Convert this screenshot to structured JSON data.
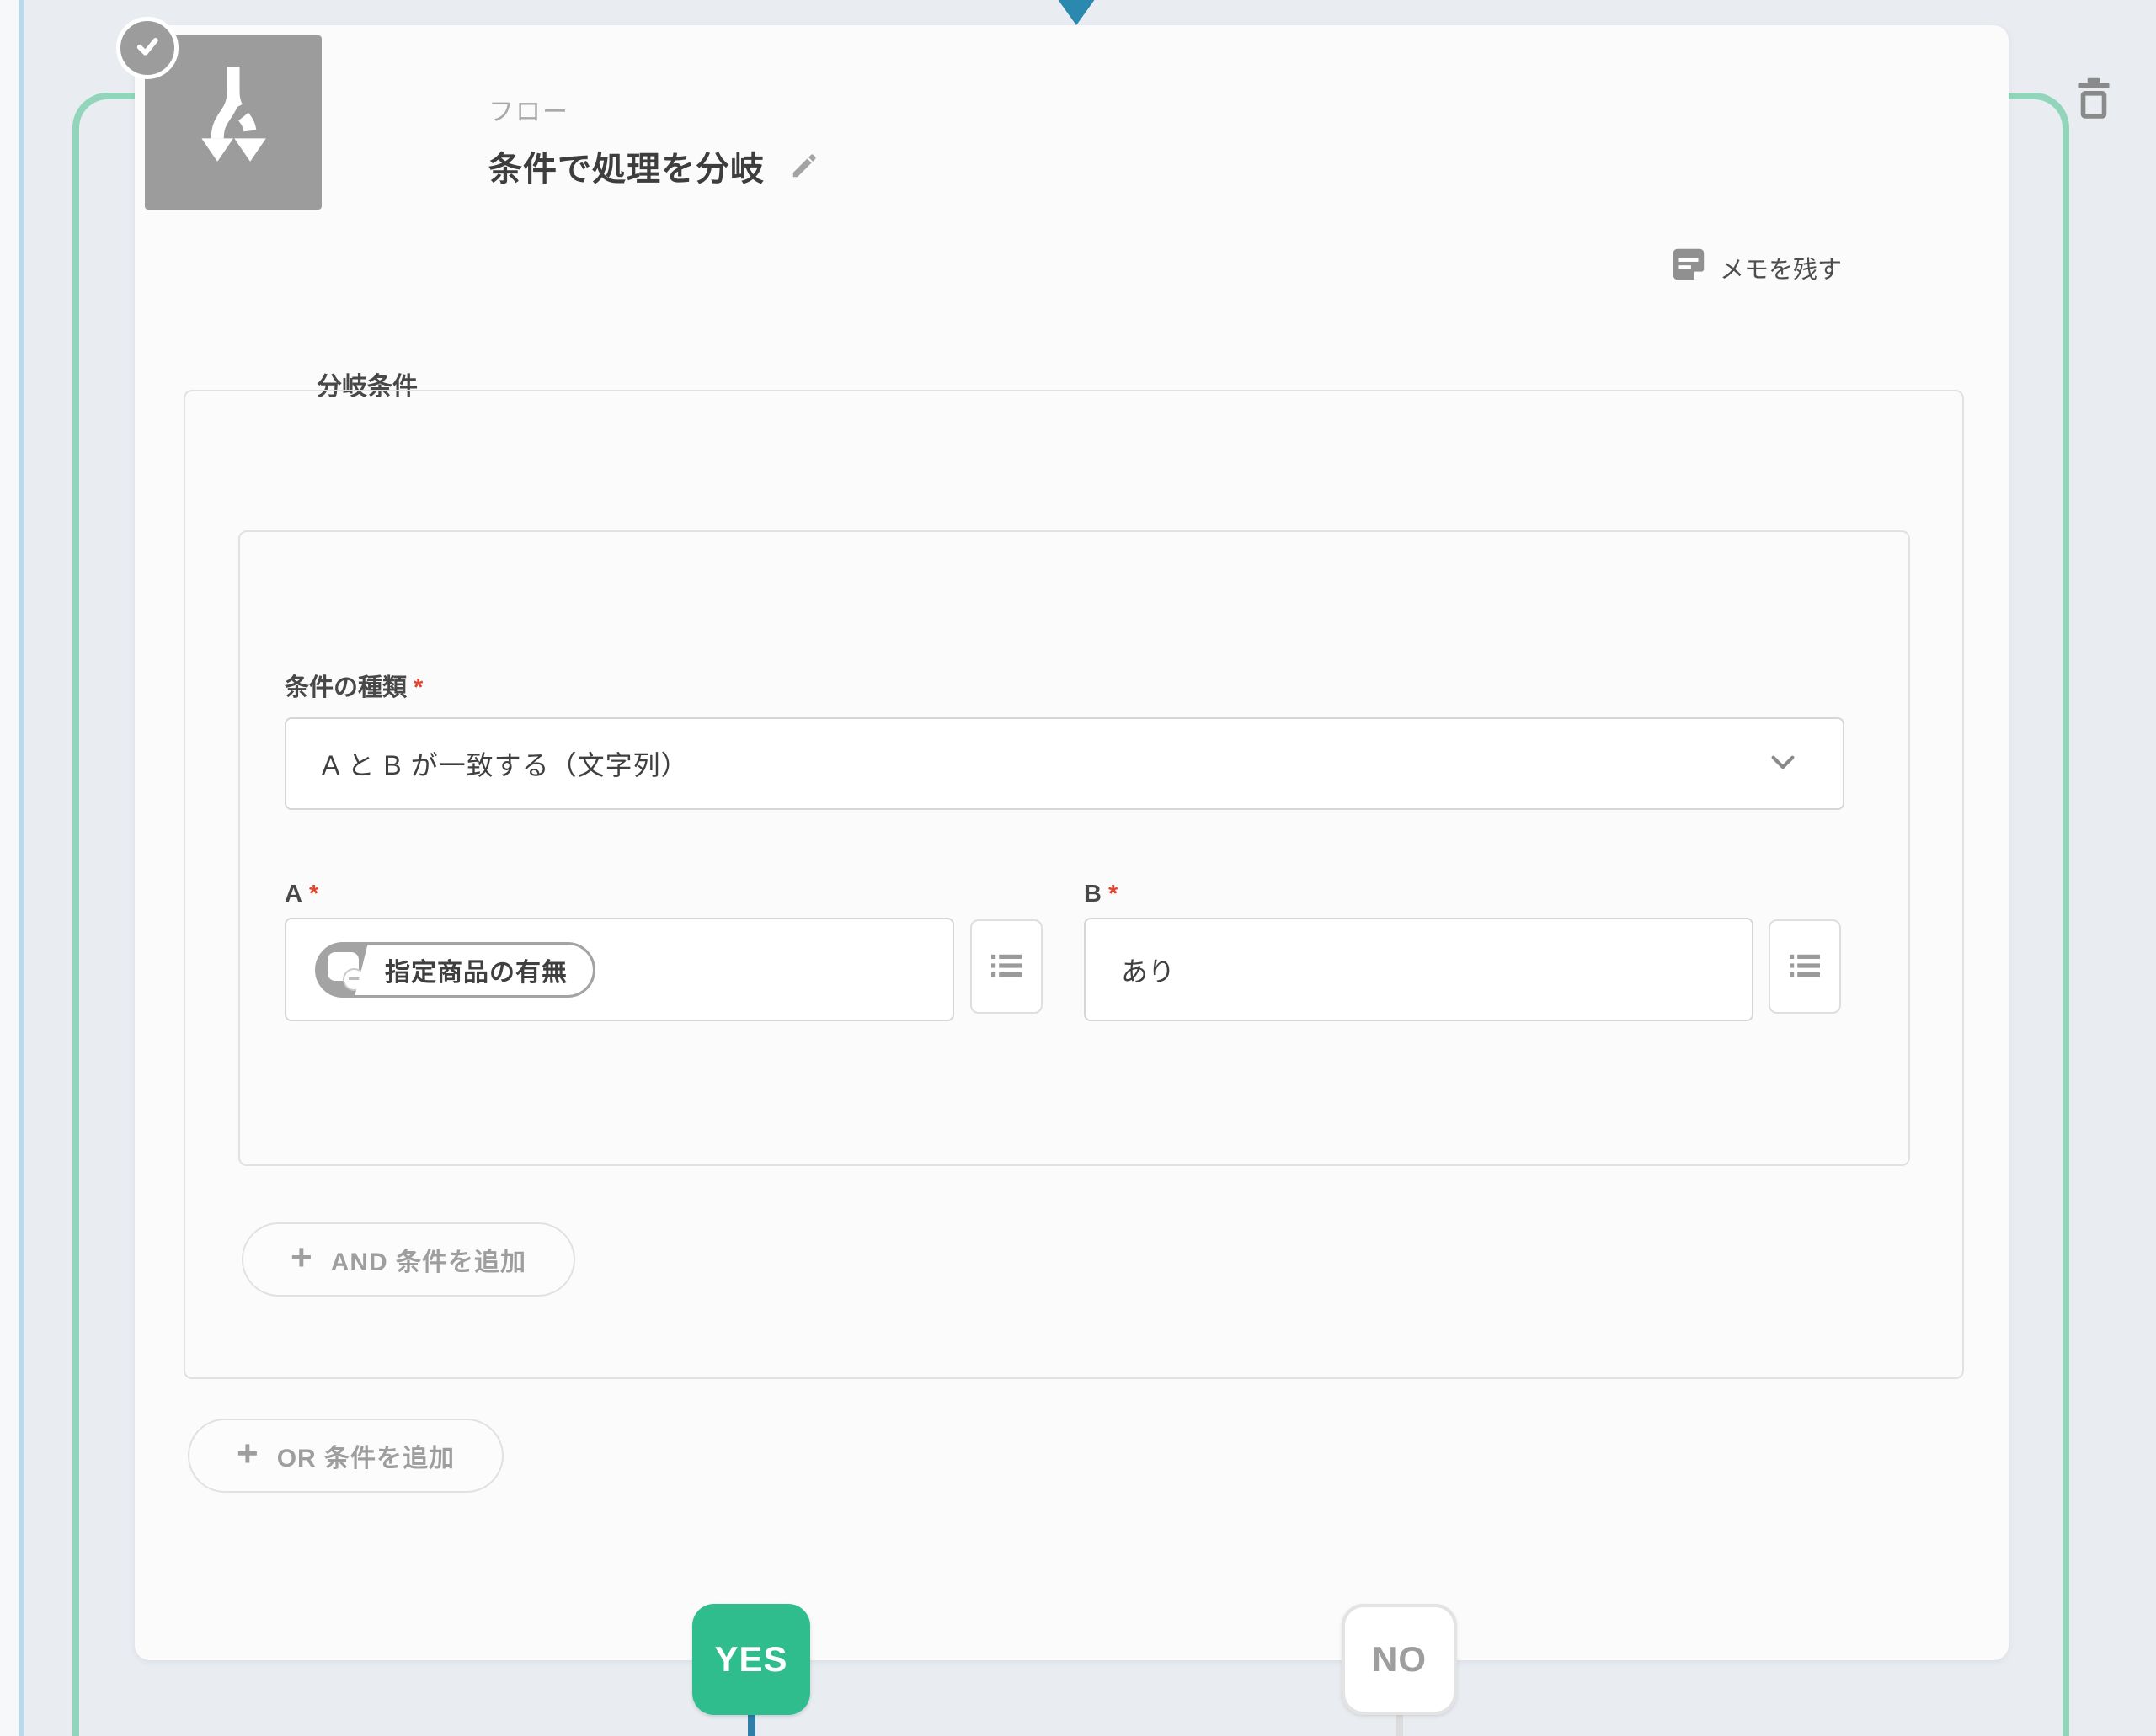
{
  "node": {
    "type_label": "フロー",
    "title": "条件で処理を分岐",
    "memo_label": "メモを残す"
  },
  "branch": {
    "section_label": "分岐条件",
    "condition_type_label": "条件の種類",
    "required_mark": "*",
    "condition_type_value": "A と B が一致する（文字列）",
    "a_label": "A",
    "a_tag": "指定商品の有無",
    "b_label": "B",
    "b_value": "あり",
    "plus": "+",
    "add_and_label": "AND 条件を追加",
    "add_or_label": "OR 条件を追加"
  },
  "outputs": {
    "yes": "YES",
    "no": "NO"
  },
  "colors": {
    "canvas": "#e9edf2",
    "rail_teal": "#92d5bb",
    "outer_rail_blue": "#bcd9e9",
    "connector_blue": "#2b89b0",
    "yes_green": "#2fbd8e",
    "icon_gray": "#9c9c9c",
    "required_red": "#e0452e"
  }
}
